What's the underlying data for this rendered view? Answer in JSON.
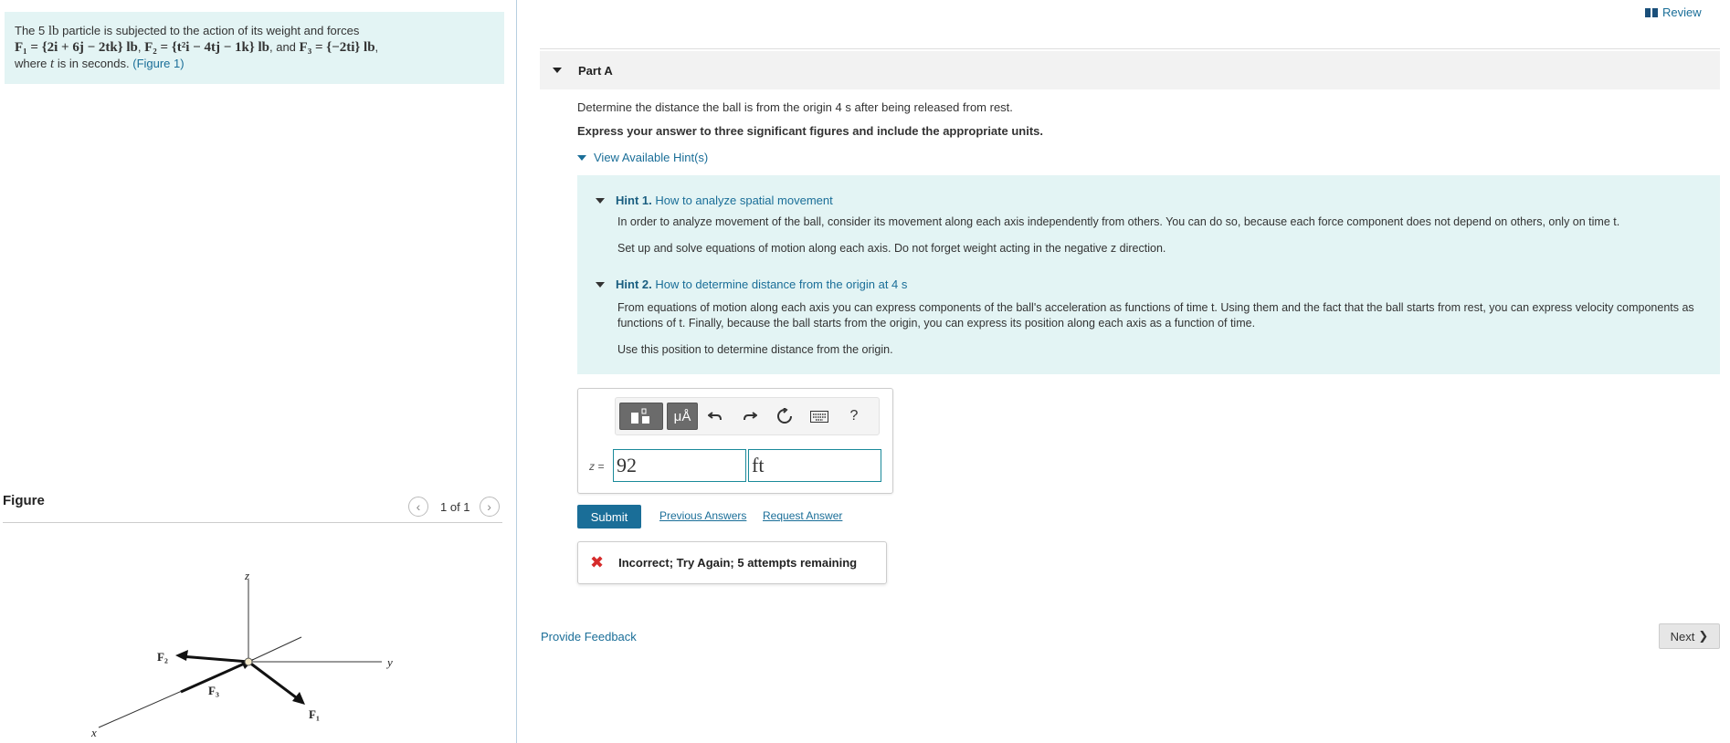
{
  "problem": {
    "line1_prefix": "The 5",
    "line1_unit": "lb",
    "line1_suffix": "particle is subjected to the action of its weight and forces",
    "line2_F1": "F₁ = {2i + 6j − 2tk} lb",
    "line2_F2": "F₂ = {t²i − 4tj − 1k} lb",
    "line2_and": ", and",
    "line2_F3": "F₃ = {−2ti} lb",
    "line3_prefix": "where",
    "line3_t": "t",
    "line3_suffix": "is in seconds.",
    "figure_link": "(Figure 1)"
  },
  "figure": {
    "heading": "Figure",
    "pager": "1 of 1",
    "labels": {
      "z": "z",
      "y": "y",
      "x": "x",
      "F1": "F₁",
      "F2": "F₂",
      "F3": "F₃"
    }
  },
  "header": {
    "review": "Review"
  },
  "part": {
    "title": "Part A"
  },
  "question": "Determine the distance the ball is from the origin 4 s after being released from rest.",
  "instruction": "Express your answer to three significant figures and include the appropriate units.",
  "hints_toggle": "View Available Hint(s)",
  "hints": [
    {
      "number": "Hint 1.",
      "title": "How to analyze spatial movement",
      "paragraphs": [
        "In order to analyze movement of the ball, consider its movement along each axis independently from others. You can do so, because each force component does not depend on others, only on time t.",
        "Set up and solve equations of motion along each axis. Do not forget weight acting in the negative z direction."
      ]
    },
    {
      "number": "Hint 2.",
      "title": "How to determine distance from the origin at 4 s",
      "paragraphs": [
        "From equations of motion along each axis you can express components of the ball's acceleration as functions of time t. Using them and the fact that the ball starts from rest, you can express velocity components as functions of t. Finally, because the ball starts from the origin, you can express its position along each axis as a function of time.",
        "Use this position to determine distance from the origin."
      ]
    }
  ],
  "toolbar": {
    "units_label": "μÅ",
    "help_label": "?"
  },
  "answer": {
    "label": "z =",
    "value": "92",
    "unit": "ft"
  },
  "buttons": {
    "submit": "Submit",
    "previous_answers": "Previous Answers",
    "request_answer": "Request Answer",
    "provide_feedback": "Provide Feedback",
    "next": "Next"
  },
  "feedback": {
    "message": "Incorrect; Try Again; 5 attempts remaining"
  },
  "colors": {
    "accent": "#1a6e98",
    "hint_bg": "#e3f4f4",
    "error": "#d62b2b"
  }
}
